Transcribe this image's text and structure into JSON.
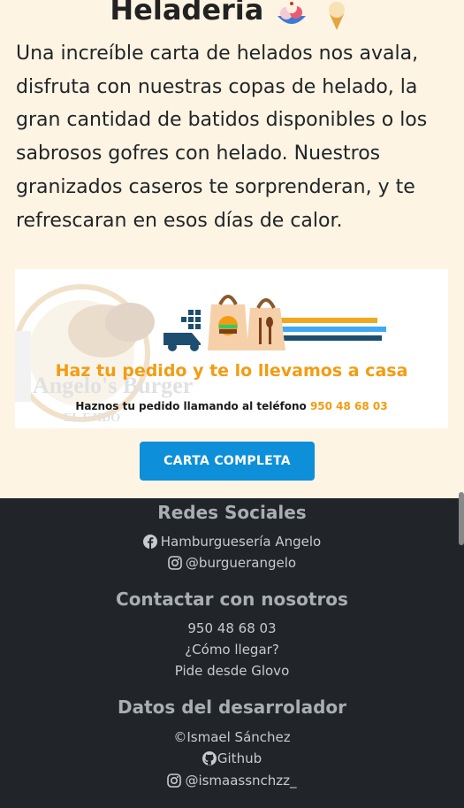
{
  "section": {
    "title": "Heladeria",
    "description": "Una increíble carta de helados nos avala, disfruta con nuestras copas de helado, la gran cantidad de batidos disponibles o los sabrosos gofres con helado. Nuestros granizados caseros te sorprenderan, y te refrescaran en esos días de calor.",
    "icons": [
      "ice-cream-bowl-icon",
      "ice-cream-cone-icon"
    ]
  },
  "banner": {
    "logo_text": "Angelo's Burger",
    "logo_sub": "EL EJIDO",
    "headline": "Haz tu pedido y te lo llevamos a casa",
    "subline_prefix": "Haznos tu pedido llamando al teléfono",
    "phone": "950 48 68 03",
    "colors": {
      "orange": "#f39c12",
      "dark_blue": "#1d4e6f",
      "light_blue": "#3fa9f5"
    }
  },
  "cta": {
    "label": "CARTA COMPLETA"
  },
  "footer": {
    "social": {
      "heading": "Redes Sociales",
      "facebook": "Hamburguesería Angelo",
      "instagram": "@burguerangelo"
    },
    "contact": {
      "heading": "Contactar con nosotros",
      "phone": "950 48 68 03",
      "directions": "¿Cómo llegar?",
      "glovo": "Pide desde Glovo"
    },
    "developer": {
      "heading": "Datos del desarrolador",
      "name": "©Ismael Sánchez",
      "github": "Github",
      "instagram": "@ismaassnchzz_"
    }
  },
  "theme": {
    "cream": "#fdf4e3",
    "footer_bg": "#212529",
    "button": "#0d8fd9"
  }
}
